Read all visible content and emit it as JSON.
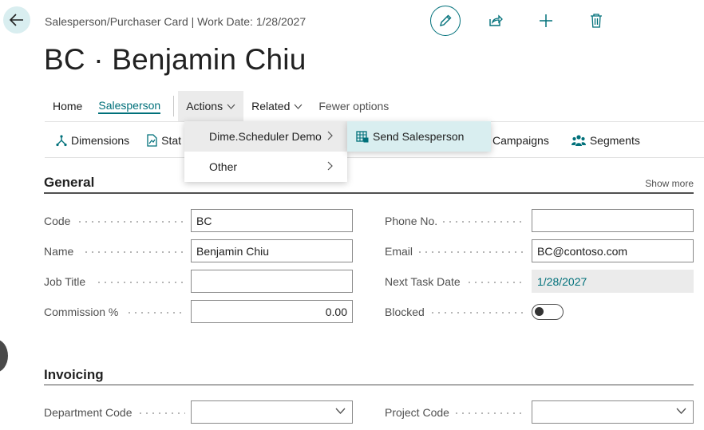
{
  "header": {
    "breadcrumb": "Salesperson/Purchaser Card | Work Date: 1/28/2027",
    "title": "BC · Benjamin Chiu",
    "icons": [
      "back-arrow-icon",
      "pencil-icon",
      "share-icon",
      "plus-icon",
      "trash-icon"
    ]
  },
  "actionbar": {
    "home": "Home",
    "salesperson": "Salesperson",
    "actions": "Actions",
    "related": "Related",
    "fewer": "Fewer options"
  },
  "promoted": {
    "dimensions": "Dimensions",
    "statistics_partial": "Stat",
    "campaigns": "Campaigns",
    "segments": "Segments"
  },
  "menu": {
    "items": [
      "Dime.Scheduler Demo",
      "Other"
    ],
    "submenu_item": "Send Salesperson"
  },
  "general": {
    "title": "General",
    "show_more": "Show more",
    "fields": {
      "code": {
        "label": "Code",
        "value": "BC"
      },
      "name": {
        "label": "Name",
        "value": "Benjamin Chiu"
      },
      "job_title": {
        "label": "Job Title",
        "value": ""
      },
      "commission": {
        "label": "Commission %",
        "value": "0.00"
      },
      "phone": {
        "label": "Phone No.",
        "value": ""
      },
      "email": {
        "label": "Email",
        "value": "BC@contoso.com"
      },
      "next_task_date": {
        "label": "Next Task Date",
        "value": "1/28/2027"
      },
      "blocked": {
        "label": "Blocked",
        "value": false
      }
    }
  },
  "invoicing": {
    "title": "Invoicing",
    "fields": {
      "department_code": {
        "label": "Department Code",
        "value": ""
      },
      "project_code": {
        "label": "Project Code",
        "value": ""
      }
    }
  },
  "colors": {
    "accent": "#00707a",
    "back_button_bg": "#d9eef0",
    "highlight_bg": "#ebebeb",
    "submenu_bg": "#d9eef0"
  }
}
